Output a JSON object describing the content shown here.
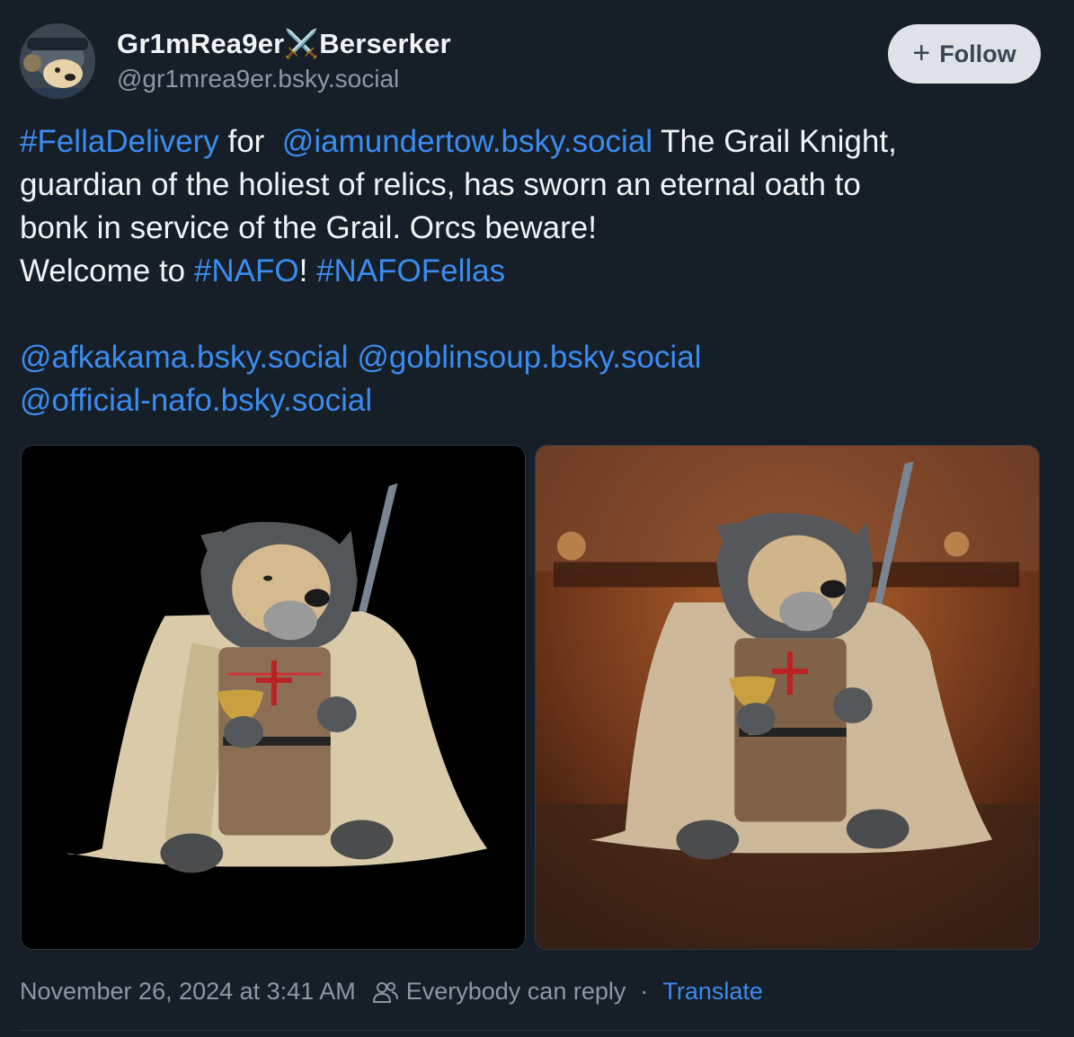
{
  "author": {
    "display_name": "Gr1mRea9er⚔️Berserker",
    "handle": "@gr1mrea9er.bsky.social",
    "avatar": "avatar-icon"
  },
  "follow_button": {
    "icon": "plus-icon",
    "label": "Follow"
  },
  "post": {
    "segments": {
      "tag_fella_delivery": "#FellaDelivery",
      "for": "for",
      "mention_iamundertow": "@iamundertow.bsky.social",
      "line1_rest": "The Grail Knight,",
      "line2": "guardian of the holiest of relics, has sworn an eternal oath to",
      "line3": "bonk in service of the Grail. Orcs beware!",
      "welcome": "Welcome to",
      "tag_nafo": "#NAFO",
      "bang": "!",
      "tag_nafofellas": "#NAFOFellas",
      "mention_afkakama": "@afkakama.bsky.social",
      "mention_goblinsoup": "@goblinsoup.bsky.social",
      "mention_official_nafo": "@official-nafo.bsky.social"
    },
    "images": [
      {
        "background": "#000000",
        "subject": "grail-knight-fella-image"
      },
      {
        "background": "#5a2e18",
        "subject": "grail-knight-fella-temple-image"
      }
    ]
  },
  "footer": {
    "timestamp": "November 26, 2024 at 3:41 AM",
    "reply_icon": "people-icon",
    "reply_setting": "Everybody can reply",
    "separator": "·",
    "translate": "Translate"
  },
  "colors": {
    "background": "#161e27",
    "link": "#3b8cf0",
    "muted": "#8b98a8",
    "follow_bg": "#dfe3e8"
  }
}
